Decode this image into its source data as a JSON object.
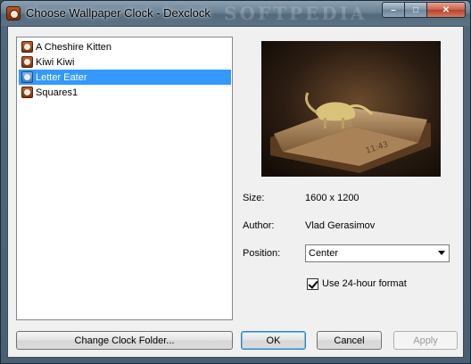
{
  "window": {
    "title": "Choose Wallpaper Clock - Dexclock",
    "watermark": "SOFTPEDIA",
    "controls": {
      "minimize": "–",
      "maximize": "□",
      "close": "✕"
    }
  },
  "clock_list": {
    "items": [
      {
        "label": "A Cheshire Kitten",
        "icon": "clock-icon"
      },
      {
        "label": "Kiwi Kiwi",
        "icon": "clock-icon"
      },
      {
        "label": "Letter Eater",
        "icon": "clock-icon",
        "selected": true
      },
      {
        "label": "Squares1",
        "icon": "clock-icon"
      }
    ]
  },
  "preview": {
    "clock_text": "11:43"
  },
  "details": {
    "size_label": "Size:",
    "size_value": "1600 x 1200",
    "author_label": "Author:",
    "author_value": "Vlad Gerasimov",
    "position_label": "Position:",
    "position_value": "Center",
    "format_checkbox_label": "Use 24-hour format",
    "format_checked": true
  },
  "buttons": {
    "change_folder": "Change Clock Folder...",
    "ok": "OK",
    "cancel": "Cancel",
    "apply": "Apply"
  },
  "colors": {
    "selection": "#3399ff",
    "title_bar": "#6a8193"
  }
}
